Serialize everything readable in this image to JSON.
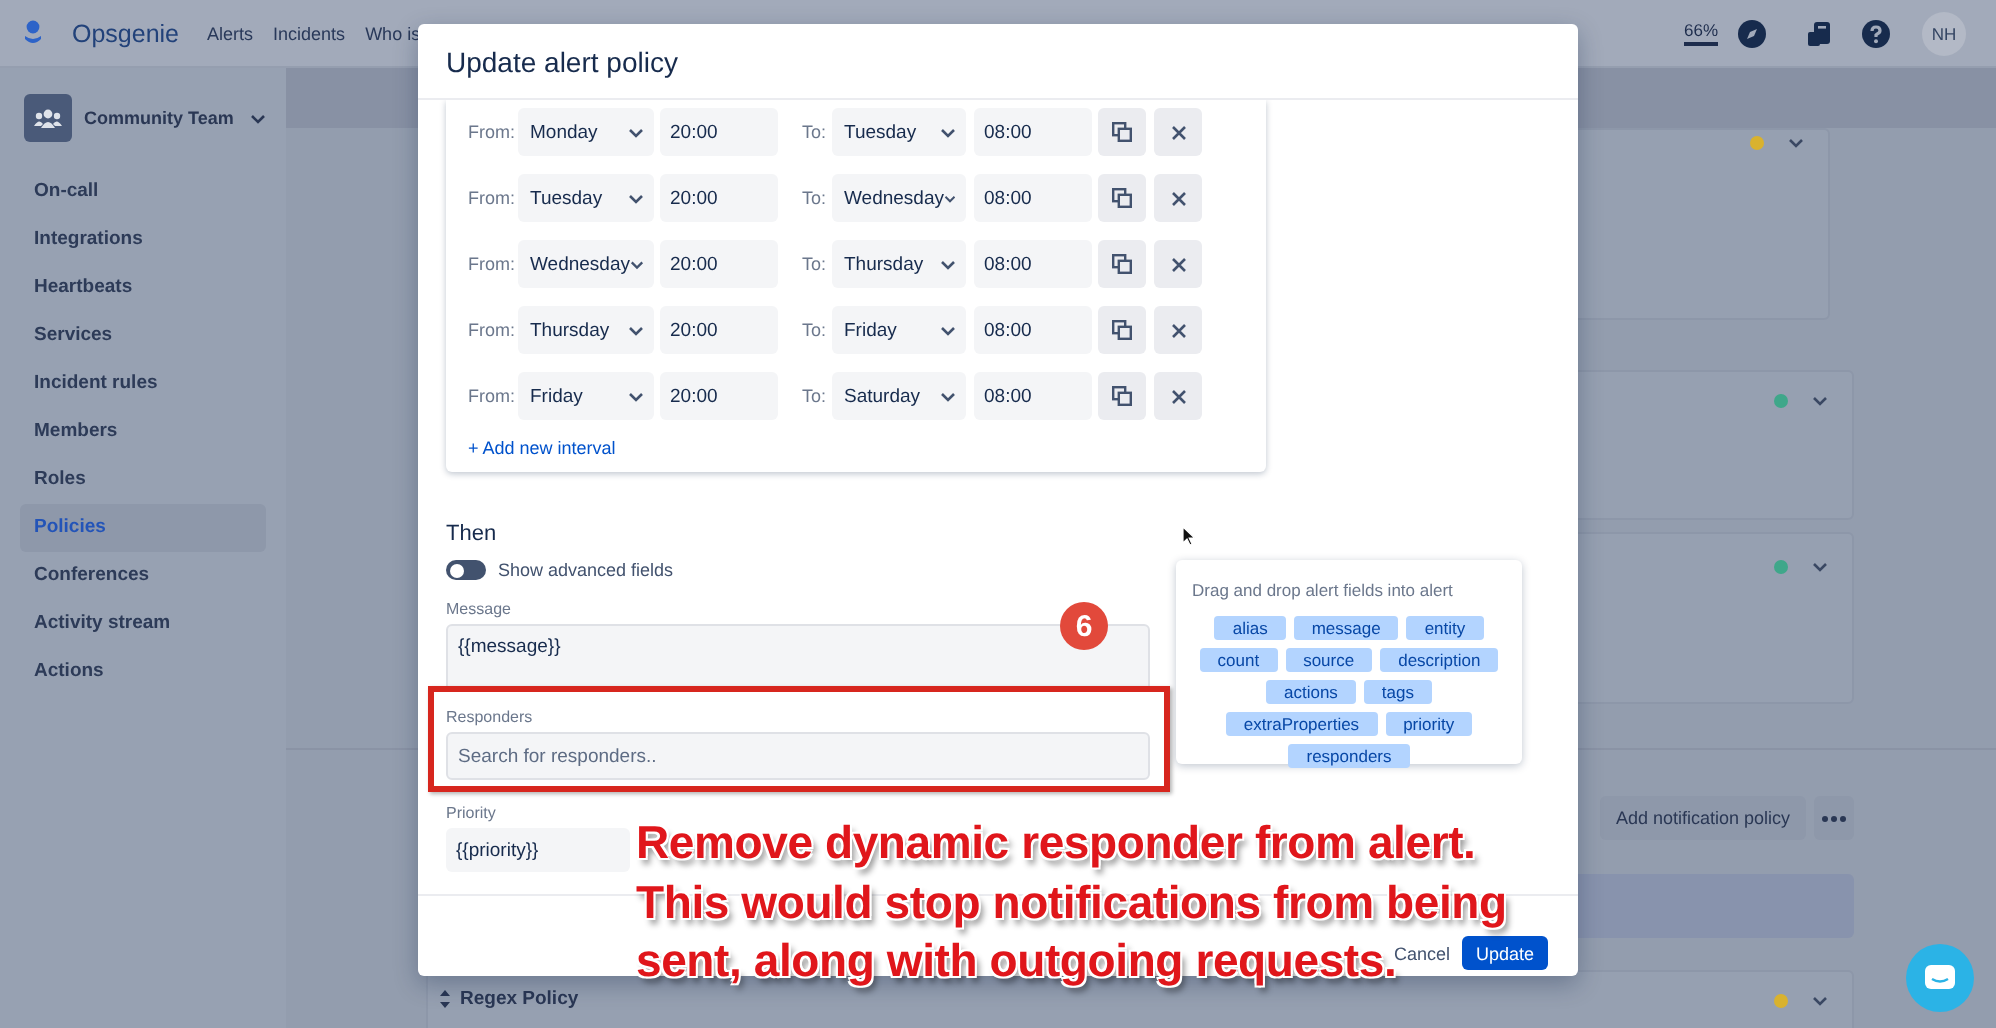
{
  "topbar": {
    "logo": "Opsgenie",
    "nav": [
      "Alerts",
      "Incidents",
      "Who is"
    ],
    "usage": "66%",
    "avatar": "NH"
  },
  "sidebar": {
    "team": "Community Team",
    "items": [
      {
        "label": "On-call",
        "selected": false
      },
      {
        "label": "Integrations",
        "selected": false
      },
      {
        "label": "Heartbeats",
        "selected": false
      },
      {
        "label": "Services",
        "selected": false
      },
      {
        "label": "Incident rules",
        "selected": false
      },
      {
        "label": "Members",
        "selected": false
      },
      {
        "label": "Roles",
        "selected": false
      },
      {
        "label": "Policies",
        "selected": true
      },
      {
        "label": "Conferences",
        "selected": false
      },
      {
        "label": "Activity stream",
        "selected": false
      },
      {
        "label": "Actions",
        "selected": false
      }
    ]
  },
  "background": {
    "cards": [
      {
        "color": "#d9b22e"
      },
      {
        "color": "#3fa78a"
      },
      {
        "color": "#3fa78a"
      }
    ],
    "add_notification_policy": "Add notification policy",
    "regex_policy": {
      "title": "Regex Policy",
      "color": "#d9b22e"
    }
  },
  "modal": {
    "title": "Update alert policy",
    "intervals": [
      {
        "from_label": "From:",
        "from_day": "Monday",
        "from_time": "20:00",
        "to_label": "To:",
        "to_day": "Tuesday",
        "to_time": "08:00"
      },
      {
        "from_label": "From:",
        "from_day": "Tuesday",
        "from_time": "20:00",
        "to_label": "To:",
        "to_day": "Wednesday",
        "to_time": "08:00"
      },
      {
        "from_label": "From:",
        "from_day": "Wednesday",
        "from_time": "20:00",
        "to_label": "To:",
        "to_day": "Thursday",
        "to_time": "08:00"
      },
      {
        "from_label": "From:",
        "from_day": "Thursday",
        "from_time": "20:00",
        "to_label": "To:",
        "to_day": "Friday",
        "to_time": "08:00"
      },
      {
        "from_label": "From:",
        "from_day": "Friday",
        "from_time": "20:00",
        "to_label": "To:",
        "to_day": "Saturday",
        "to_time": "08:00"
      }
    ],
    "add_interval": "+ Add new interval",
    "then": "Then",
    "advanced_toggle": {
      "label": "Show advanced fields",
      "on": false
    },
    "fields": [
      {
        "kind": "textarea",
        "label": "Message",
        "value": "{{message}}"
      },
      {
        "kind": "input",
        "label": "Responders",
        "placeholder": "Search for responders.."
      },
      {
        "kind": "input",
        "label": "Priority",
        "value": "{{priority}}"
      }
    ],
    "drag_panel": {
      "hint": "Drag and drop alert fields into alert",
      "tags": [
        "alias",
        "message",
        "entity",
        "count",
        "source",
        "description",
        "actions",
        "tags",
        "extraProperties",
        "priority",
        "responders"
      ]
    },
    "cancel": "Cancel",
    "update": "Update"
  },
  "annotation": {
    "step": "6",
    "lines": [
      "Remove dynamic responder from alert.",
      "This would stop notifications from being",
      "sent, along with outgoing requests."
    ]
  }
}
